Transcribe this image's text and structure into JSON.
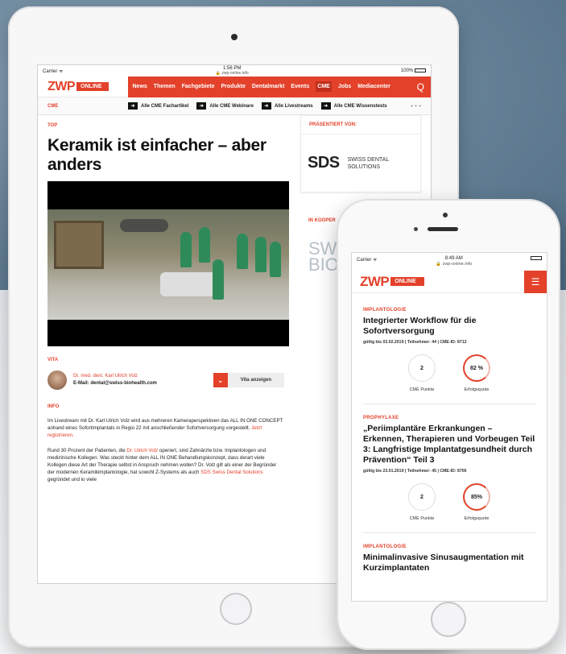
{
  "ipad": {
    "status": {
      "carrier": "Carrier ᯤ",
      "time": "1:56 PM",
      "url": "🔒 zwp-online.info",
      "battery": "100%"
    },
    "logo": {
      "brand": "ZWP",
      "badge": "ONLINE"
    },
    "nav": {
      "items": [
        "News",
        "Themen",
        "Fachgebiete",
        "Produkte",
        "Dentalmarkt",
        "Events",
        "CME",
        "Jobs",
        "Mediacenter"
      ],
      "active": "CME",
      "search_icon": "Q"
    },
    "subnav": {
      "section": "CME",
      "links": [
        "Alle CME Fachartikel",
        "Alle CME Webinare",
        "Alle Livestreams",
        "Alle CME Wissenstests"
      ],
      "more": "• • •"
    },
    "article": {
      "tag": "TOP",
      "headline": "Keramik ist einfacher – aber anders",
      "vita_tag": "VITA",
      "vita_name": "Dr. med. dent. Karl Ulrich Volz",
      "vita_email": "E-Mail: dental@swiss-biohealth.com",
      "vita_button": "Vita anzeigen",
      "info_tag": "INFO",
      "para1_a": "Im Livestream mit Dr. Karl Ulrich Volz wird aus mehreren Kameraperspektiven das ALL IN ONE CONCEPT anhand eines Sofortimplantats in Regio 22 mit anschließender Sofortversorgung vorgestellt. ",
      "para1_link": "Jetzt registrieren.",
      "para2_a": "Rund 30 Prozent der Patienten, die ",
      "para2_link1": "Dr. Ulrich Volz",
      "para2_b": " operiert, sind Zahnärzte bzw. Implantologen und medizinische Kollegen. Was steckt hinter dem ALL IN ONE Behandlungskonzept, dass derart viele Kollegen diese Art der Therapie selbst in Anspruch nehmen wollen? Dr. Volz gilt als einer der Begründer der modernen Keramikimplantologie, hat sowohl Z-Systems als auch ",
      "para2_link2": "SDS Swiss Dental Solutions",
      "para2_c": " gegründet und io viele"
    },
    "side": {
      "presented_by": "PRÄSENTIERT VON:",
      "sds_mark": "SDS",
      "sds_line1": "SWISS DENTAL",
      "sds_line2": "SOLUTIONS",
      "coop": "IN KOOPER",
      "swiss_bio_1": "SWI",
      "swiss_bio_2": "BIOH"
    }
  },
  "iphone": {
    "status": {
      "carrier": "Carrier ᯤ",
      "time": "8:49 AM",
      "url": "🔒 zwp-online.info"
    },
    "logo": {
      "brand": "ZWP",
      "badge": "ONLINE"
    },
    "menu_icon": "☰",
    "articles": [
      {
        "category": "IMPLANTOLOGIE",
        "title": "Integrierter Workflow für die Sofortversorgung",
        "meta": "gültig bis 03.02.2019 | Teilnehmer: 44 | CME-ID: 8712",
        "points": "2",
        "points_label": "CME Punkte",
        "quota": "82 %",
        "quota_label": "Erfolgsquote"
      },
      {
        "category": "PROPHYLAXE",
        "title": "„Periimplantäre Erkrankungen – Erkennen, Therapieren und Vorbeugen Teil 3: Langfristige Implantatgesundheit durch Prävention“ Teil 3",
        "meta": "gültig bis 23.01.2019 | Teilnehmer: 45 | CME-ID: 8706",
        "points": "2",
        "points_label": "CME Punkte",
        "quota": "85%",
        "quota_label": "Erfolgsquote"
      },
      {
        "category": "IMPLANTOLOGIE",
        "title": "Minimalinvasive Sinusaugmentation mit Kurzimplantaten"
      }
    ]
  }
}
